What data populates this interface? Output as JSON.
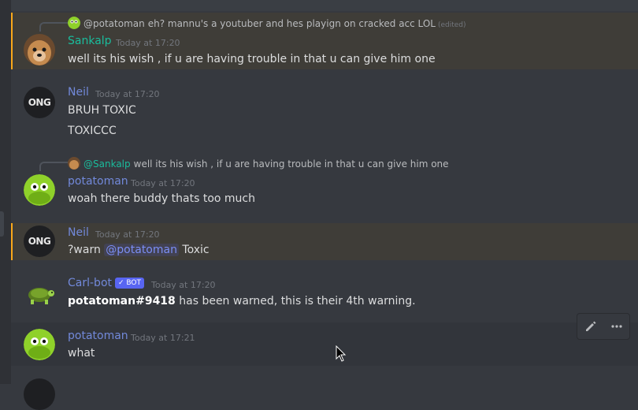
{
  "messages": [
    {
      "reply_name": "@potatoman",
      "reply_text": "eh? mannu's a youtuber and hes playign on cracked acc LOL",
      "reply_edited": "(edited)",
      "author": "Sankalp",
      "author_color": "#1abc9c",
      "time": "Today at 17:20",
      "lines": [
        "well its his wish , if u are having trouble in that u can give him one"
      ]
    },
    {
      "author": "Neil",
      "author_color": "#7289da",
      "time": "Today at 17:20",
      "lines": [
        "BRUH TOXIC",
        "TOXICCC"
      ],
      "avatar_text": "ONG"
    },
    {
      "reply_name": "@Sankalp",
      "reply_text": "well its his wish , if u are having trouble in that u can give him one",
      "author": "potatoman",
      "author_color": "#7289da",
      "time": "Today at 17:20",
      "lines": [
        "woah there buddy thats too much"
      ]
    },
    {
      "author": "Neil",
      "author_color": "#7289da",
      "time": "Today at 17:20",
      "text_prefix": "?warn",
      "mention": "@potatoman",
      "text_suffix": "Toxic",
      "avatar_text": "ONG"
    },
    {
      "author": "Carl-bot",
      "author_color": "#7289da",
      "bot_badge": "✓ BOT",
      "time": "Today at 17:20",
      "bold": "potatoman#9418",
      "rest": "has been warned, this is their 4th warning."
    },
    {
      "author": "potatoman",
      "author_color": "#7289da",
      "time": "Today at 17:21",
      "lines": [
        "what"
      ]
    }
  ],
  "icons": {
    "edit": "pencil-icon",
    "more": "ellipsis-icon"
  }
}
